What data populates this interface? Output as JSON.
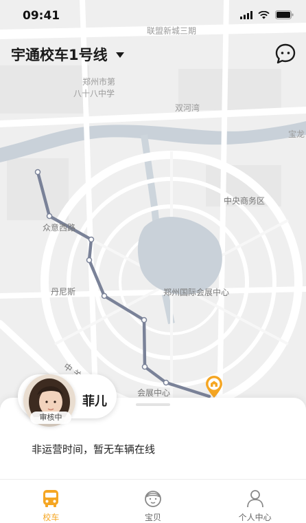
{
  "status_bar": {
    "time": "09:41"
  },
  "header": {
    "route_title": "宇通校车1号线"
  },
  "map": {
    "labels": {
      "lianmeng": "联盟新城三期",
      "school_line1": "郑州市第",
      "school_line2": "八十八中学",
      "shuanghewan": "双河湾",
      "baolong": "宝龙",
      "cbd": "中央商务区",
      "zhongyi_road": "众意西路",
      "danisi": "丹尼斯",
      "expo_center": "郑州国际会展中心",
      "expo_stop": "会展中心",
      "road_fragment": "中 关"
    }
  },
  "kid": {
    "name": "菲儿",
    "status": "审核中"
  },
  "sheet": {
    "message": "非运营时间，暂无车辆在线"
  },
  "tabs": [
    {
      "label": "校车",
      "icon": "bus-icon",
      "active": true
    },
    {
      "label": "宝贝",
      "icon": "baby-icon",
      "active": false
    },
    {
      "label": "个人中心",
      "icon": "person-icon",
      "active": false
    }
  ],
  "colors": {
    "accent": "#f5a623",
    "route": "#7a8298",
    "water": "#c9d1d9"
  }
}
